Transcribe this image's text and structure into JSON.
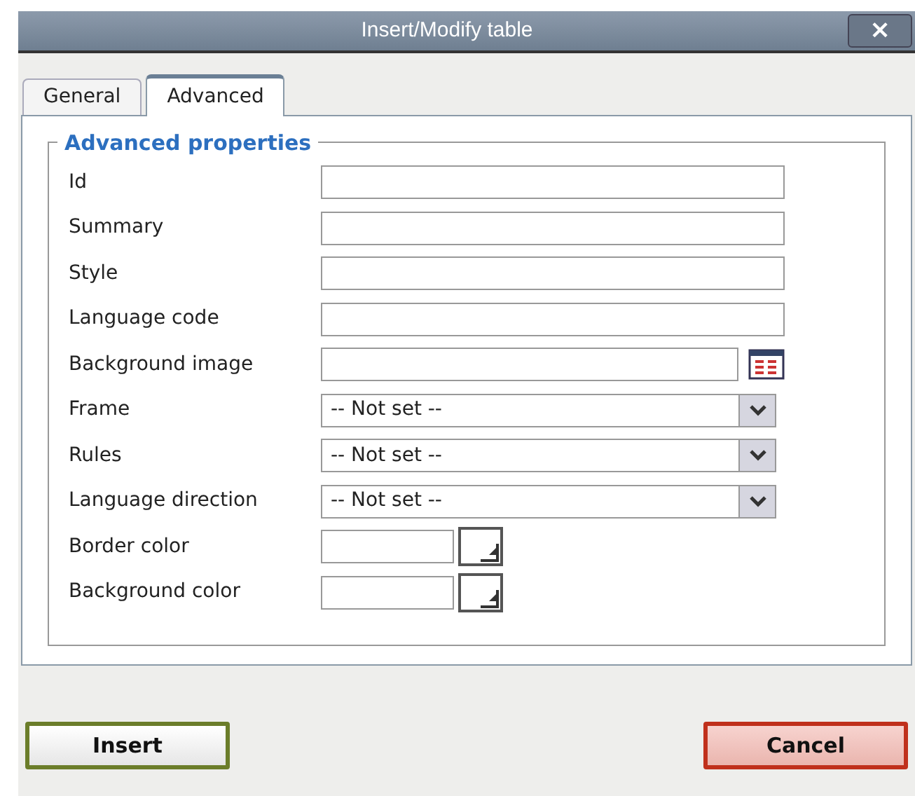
{
  "window": {
    "title": "Insert/Modify table",
    "close": "×"
  },
  "tabs": [
    {
      "label": "General",
      "selected": false
    },
    {
      "label": "Advanced",
      "selected": true
    }
  ],
  "fieldset": {
    "legend": "Advanced properties",
    "rows": [
      {
        "kind": "text",
        "label": "Id"
      },
      {
        "kind": "text",
        "label": "Summary"
      },
      {
        "kind": "text",
        "label": "Style"
      },
      {
        "kind": "text",
        "label": "Language code"
      },
      {
        "kind": "browse",
        "label": "Background image"
      },
      {
        "kind": "select",
        "label": "Frame",
        "value": "-- Not set --"
      },
      {
        "kind": "select",
        "label": "Rules",
        "value": "-- Not set --"
      },
      {
        "kind": "select",
        "label": "Language direction",
        "value": "-- Not set --"
      },
      {
        "kind": "color",
        "label": "Border color"
      },
      {
        "kind": "color",
        "label": "Background color"
      }
    ]
  },
  "buttons": [
    {
      "kind": "insert",
      "label": "Insert"
    },
    {
      "kind": "cancel",
      "label": "Cancel"
    }
  ]
}
